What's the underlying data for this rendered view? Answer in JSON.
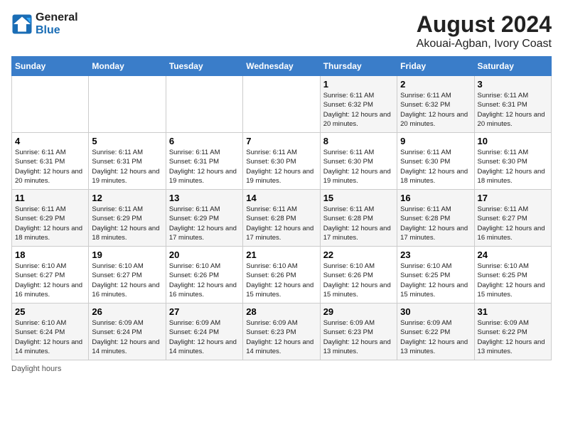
{
  "logo": {
    "name": "General",
    "name2": "Blue"
  },
  "title": "August 2024",
  "subtitle": "Akouai-Agban, Ivory Coast",
  "days_of_week": [
    "Sunday",
    "Monday",
    "Tuesday",
    "Wednesday",
    "Thursday",
    "Friday",
    "Saturday"
  ],
  "weeks": [
    [
      {
        "day": "",
        "info": ""
      },
      {
        "day": "",
        "info": ""
      },
      {
        "day": "",
        "info": ""
      },
      {
        "day": "",
        "info": ""
      },
      {
        "day": "1",
        "info": "Sunrise: 6:11 AM\nSunset: 6:32 PM\nDaylight: 12 hours and 20 minutes."
      },
      {
        "day": "2",
        "info": "Sunrise: 6:11 AM\nSunset: 6:32 PM\nDaylight: 12 hours and 20 minutes."
      },
      {
        "day": "3",
        "info": "Sunrise: 6:11 AM\nSunset: 6:31 PM\nDaylight: 12 hours and 20 minutes."
      }
    ],
    [
      {
        "day": "4",
        "info": "Sunrise: 6:11 AM\nSunset: 6:31 PM\nDaylight: 12 hours and 20 minutes."
      },
      {
        "day": "5",
        "info": "Sunrise: 6:11 AM\nSunset: 6:31 PM\nDaylight: 12 hours and 19 minutes."
      },
      {
        "day": "6",
        "info": "Sunrise: 6:11 AM\nSunset: 6:31 PM\nDaylight: 12 hours and 19 minutes."
      },
      {
        "day": "7",
        "info": "Sunrise: 6:11 AM\nSunset: 6:30 PM\nDaylight: 12 hours and 19 minutes."
      },
      {
        "day": "8",
        "info": "Sunrise: 6:11 AM\nSunset: 6:30 PM\nDaylight: 12 hours and 19 minutes."
      },
      {
        "day": "9",
        "info": "Sunrise: 6:11 AM\nSunset: 6:30 PM\nDaylight: 12 hours and 18 minutes."
      },
      {
        "day": "10",
        "info": "Sunrise: 6:11 AM\nSunset: 6:30 PM\nDaylight: 12 hours and 18 minutes."
      }
    ],
    [
      {
        "day": "11",
        "info": "Sunrise: 6:11 AM\nSunset: 6:29 PM\nDaylight: 12 hours and 18 minutes."
      },
      {
        "day": "12",
        "info": "Sunrise: 6:11 AM\nSunset: 6:29 PM\nDaylight: 12 hours and 18 minutes."
      },
      {
        "day": "13",
        "info": "Sunrise: 6:11 AM\nSunset: 6:29 PM\nDaylight: 12 hours and 17 minutes."
      },
      {
        "day": "14",
        "info": "Sunrise: 6:11 AM\nSunset: 6:28 PM\nDaylight: 12 hours and 17 minutes."
      },
      {
        "day": "15",
        "info": "Sunrise: 6:11 AM\nSunset: 6:28 PM\nDaylight: 12 hours and 17 minutes."
      },
      {
        "day": "16",
        "info": "Sunrise: 6:11 AM\nSunset: 6:28 PM\nDaylight: 12 hours and 17 minutes."
      },
      {
        "day": "17",
        "info": "Sunrise: 6:11 AM\nSunset: 6:27 PM\nDaylight: 12 hours and 16 minutes."
      }
    ],
    [
      {
        "day": "18",
        "info": "Sunrise: 6:10 AM\nSunset: 6:27 PM\nDaylight: 12 hours and 16 minutes."
      },
      {
        "day": "19",
        "info": "Sunrise: 6:10 AM\nSunset: 6:27 PM\nDaylight: 12 hours and 16 minutes."
      },
      {
        "day": "20",
        "info": "Sunrise: 6:10 AM\nSunset: 6:26 PM\nDaylight: 12 hours and 16 minutes."
      },
      {
        "day": "21",
        "info": "Sunrise: 6:10 AM\nSunset: 6:26 PM\nDaylight: 12 hours and 15 minutes."
      },
      {
        "day": "22",
        "info": "Sunrise: 6:10 AM\nSunset: 6:26 PM\nDaylight: 12 hours and 15 minutes."
      },
      {
        "day": "23",
        "info": "Sunrise: 6:10 AM\nSunset: 6:25 PM\nDaylight: 12 hours and 15 minutes."
      },
      {
        "day": "24",
        "info": "Sunrise: 6:10 AM\nSunset: 6:25 PM\nDaylight: 12 hours and 15 minutes."
      }
    ],
    [
      {
        "day": "25",
        "info": "Sunrise: 6:10 AM\nSunset: 6:24 PM\nDaylight: 12 hours and 14 minutes."
      },
      {
        "day": "26",
        "info": "Sunrise: 6:09 AM\nSunset: 6:24 PM\nDaylight: 12 hours and 14 minutes."
      },
      {
        "day": "27",
        "info": "Sunrise: 6:09 AM\nSunset: 6:24 PM\nDaylight: 12 hours and 14 minutes."
      },
      {
        "day": "28",
        "info": "Sunrise: 6:09 AM\nSunset: 6:23 PM\nDaylight: 12 hours and 14 minutes."
      },
      {
        "day": "29",
        "info": "Sunrise: 6:09 AM\nSunset: 6:23 PM\nDaylight: 12 hours and 13 minutes."
      },
      {
        "day": "30",
        "info": "Sunrise: 6:09 AM\nSunset: 6:22 PM\nDaylight: 12 hours and 13 minutes."
      },
      {
        "day": "31",
        "info": "Sunrise: 6:09 AM\nSunset: 6:22 PM\nDaylight: 12 hours and 13 minutes."
      }
    ]
  ],
  "footer": "Daylight hours"
}
